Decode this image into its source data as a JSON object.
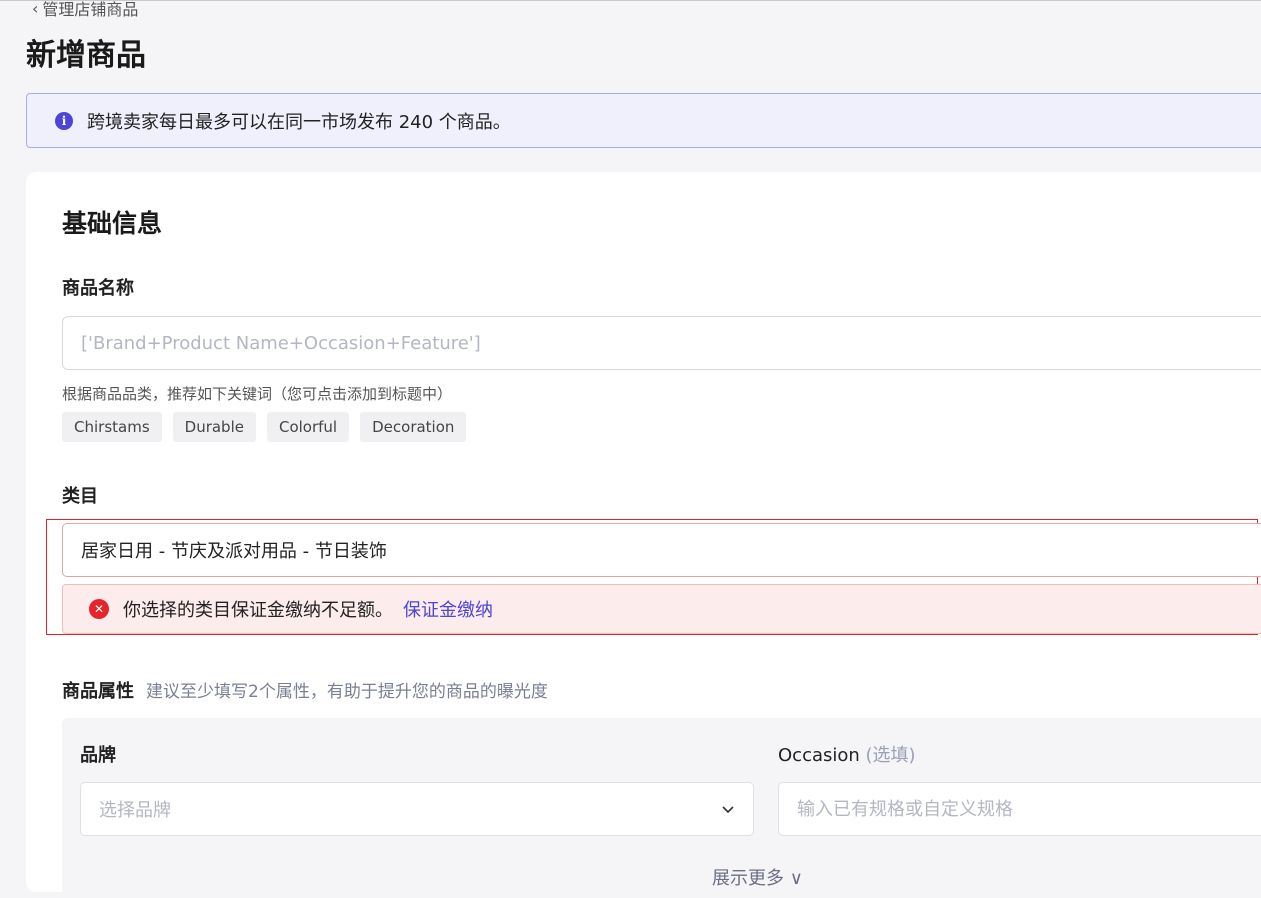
{
  "header": {
    "back_label": "管理店铺商品",
    "page_title": "新增商品"
  },
  "notice": {
    "icon": "info-icon",
    "text": "跨境卖家每日最多可以在同一市场发布 240 个商品。"
  },
  "basic_info": {
    "section_title": "基础信息",
    "product_name": {
      "label": "商品名称",
      "placeholder": "['Brand+Product Name+Occasion+Feature']",
      "value": ""
    },
    "keyword_hint": "根据商品品类，推荐如下关键词（您可点击添加到标题中）",
    "keywords": [
      "Chirstams",
      "Durable",
      "Colorful",
      "Decoration"
    ],
    "category": {
      "label": "类目",
      "value": "居家日用 - 节庆及派对用品 - 节日装饰",
      "error_text": "你选择的类目保证金缴纳不足额。",
      "error_link": "保证金缴纳"
    }
  },
  "attributes": {
    "label": "商品属性",
    "hint": "建议至少填写2个属性，有助于提升您的商品的曝光度",
    "brand": {
      "label": "品牌",
      "placeholder": "选择品牌"
    },
    "occasion": {
      "label": "Occasion",
      "optional": "(选填)",
      "placeholder": "输入已有规格或自定义规格"
    },
    "show_more": "展示更多 ∨"
  },
  "colors": {
    "accent": "#4a46d6",
    "error": "#e5252b",
    "notice_bg": "#eff0fb"
  }
}
